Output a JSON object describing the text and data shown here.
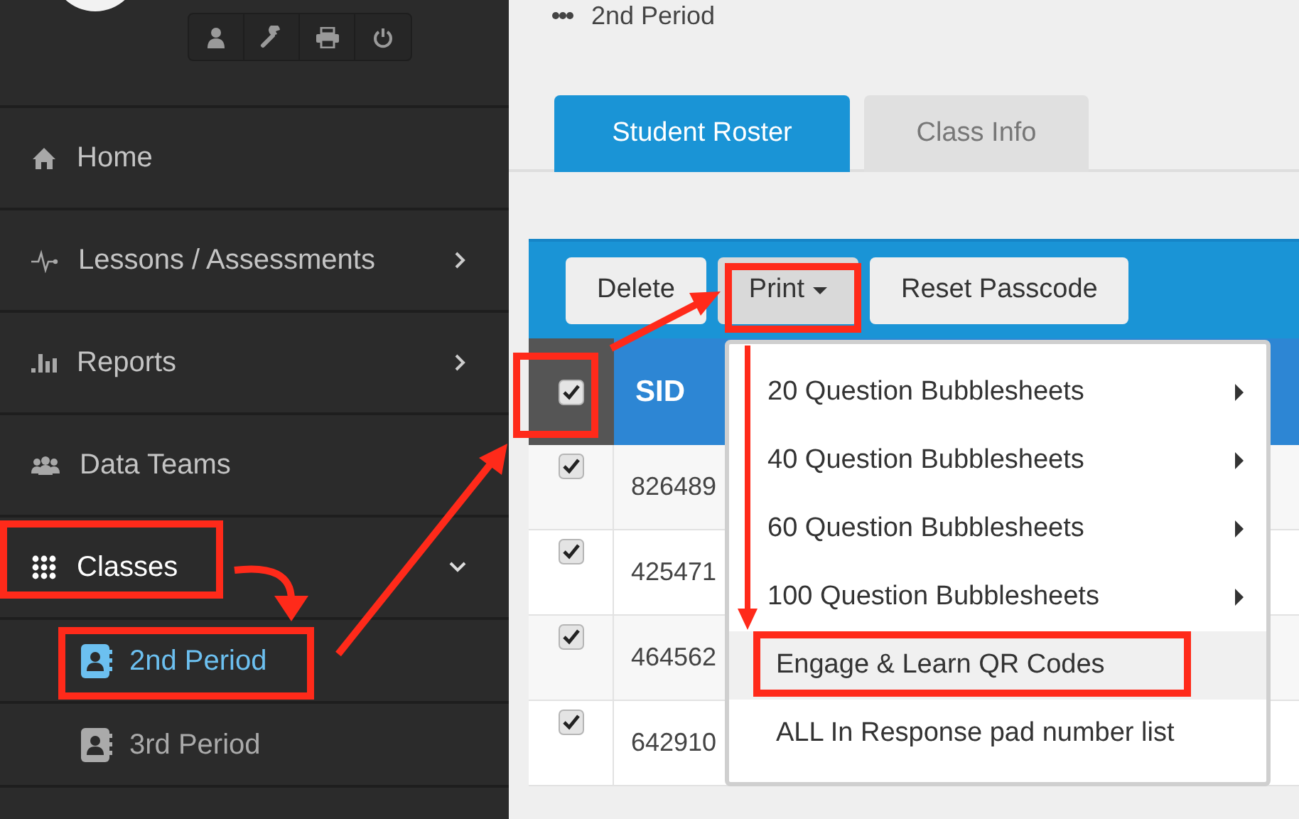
{
  "page": {
    "title": "2nd Period"
  },
  "sidebar": {
    "items": [
      {
        "label": "Home",
        "selected": false
      },
      {
        "label": "Lessons / Assessments",
        "selected": false,
        "expanded": false
      },
      {
        "label": "Reports",
        "selected": false,
        "expanded": false
      },
      {
        "label": "Data Teams",
        "selected": false
      },
      {
        "label": "Classes",
        "selected": true,
        "expanded": true,
        "children": [
          {
            "label": "2nd Period",
            "selected": true
          },
          {
            "label": "3rd Period",
            "selected": false
          }
        ]
      }
    ]
  },
  "tabs": [
    {
      "label": "Student Roster",
      "selected": true
    },
    {
      "label": "Class Info",
      "selected": false
    }
  ],
  "toolbar": {
    "buttons": [
      {
        "label": "Delete",
        "dropdown": false,
        "pressed": false
      },
      {
        "label": "Print",
        "dropdown": true,
        "pressed": true
      },
      {
        "label": "Reset Passcode",
        "dropdown": false,
        "pressed": false
      }
    ]
  },
  "table": {
    "select_all_checked": true,
    "columns": [
      "SID"
    ],
    "rows": [
      {
        "checked": true,
        "sid": "826489"
      },
      {
        "checked": true,
        "sid": "425471"
      },
      {
        "checked": true,
        "sid": "464562"
      },
      {
        "checked": true,
        "sid": "642910"
      }
    ]
  },
  "print_menu": {
    "items": [
      {
        "label": "20 Question Bubblesheets",
        "submenu": true,
        "selected": false
      },
      {
        "label": "40 Question Bubblesheets",
        "submenu": true,
        "selected": false
      },
      {
        "label": "60 Question Bubblesheets",
        "submenu": true,
        "selected": false
      },
      {
        "label": "100 Question Bubblesheets",
        "submenu": true,
        "selected": false
      },
      {
        "label": "Engage & Learn QR Codes",
        "submenu": false,
        "selected": true
      },
      {
        "label": "ALL In Response pad number list",
        "submenu": false,
        "selected": false
      }
    ]
  }
}
